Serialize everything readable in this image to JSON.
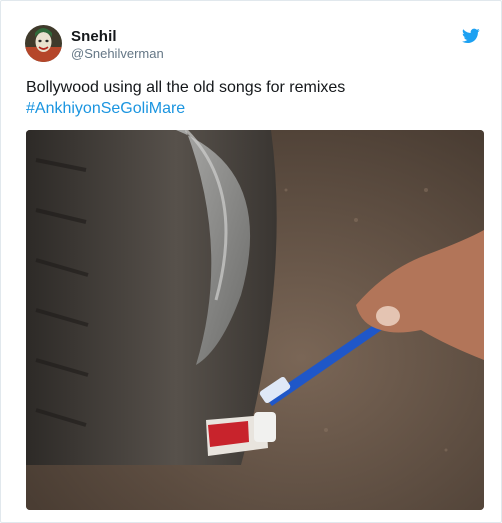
{
  "tweet": {
    "author": {
      "name": "Snehil",
      "handle": "@Snehilverman",
      "avatar_icon": "joker-avatar"
    },
    "brand_icon": "twitter-bird-icon",
    "text": "Bollywood using all the old songs for remixes",
    "hashtag": "#AnkhiyonSeGoliMare",
    "media_icon": "photo-tire-toothbrush-toothpaste",
    "colors": {
      "accent": "#1da1f2",
      "hashtag": "#1b95e0",
      "handle": "#657786",
      "text": "#14171a"
    }
  }
}
